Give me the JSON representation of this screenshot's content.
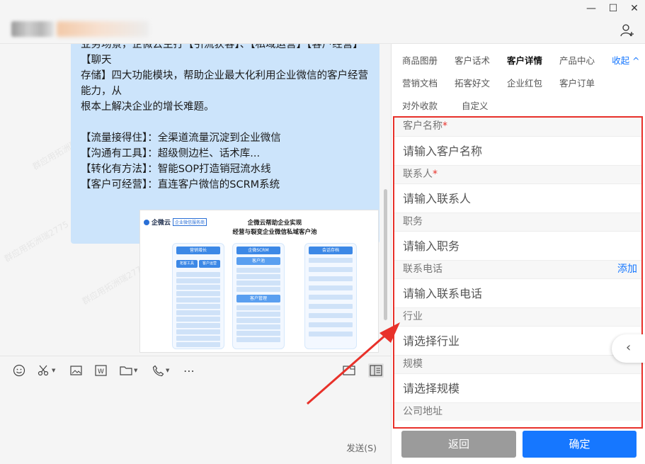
{
  "window": {
    "minimize_glyph": "—",
    "maximize_glyph": "☐",
    "close_glyph": "✕"
  },
  "chat": {
    "message_lines": [
      "业务场景，企微云主打【引流获客】、【私域运营】【客户经营】【聊天",
      "存储】四大功能模块，帮助企业最大化利用企业微信的客户经营能力，从",
      "根本上解决企业的增长难题。"
    ],
    "bullet_lines": [
      "【流量接得住】：全渠道流量沉淀到企业微信",
      "【沟通有工具】：超级侧边栏、话术库...",
      "【转化有方法】：智能SOP打造销冠流水线",
      "【客户可经营】：直连客户微信的SCRM系统"
    ],
    "watermark": "群应用拓洲瑞2775",
    "image": {
      "logo_text": "企微云",
      "logo_tag": "企业微信服务商",
      "title_line1": "企微云帮助企业实现",
      "title_line2": "经营与裂变企业微信私域客户池",
      "col1_header": "营销增长",
      "col1_sub1": "拓客工具",
      "col1_sub2": "客户运营",
      "col2_header": "企微SCRM",
      "col2_sub1": "客户池",
      "col2_sub2": "客户管理",
      "col3_header": "会话存档"
    }
  },
  "toolbar": {
    "send_label": "发送(S)"
  },
  "panel": {
    "tabs_row1": [
      "商品图册",
      "客户话术",
      "客户详情",
      "产品中心"
    ],
    "active_tab": "客户详情",
    "collapse_label": "收起 ^",
    "tabs_row2": [
      "营销文档",
      "拓客好文",
      "企业红包",
      "客户订单"
    ],
    "tabs_row3": [
      "对外收款",
      "自定义"
    ],
    "form": {
      "customer_name_label": "客户名称",
      "customer_name_placeholder": "请输入客户名称",
      "contact_label": "联系人",
      "contact_placeholder": "请输入联系人",
      "position_label": "职务",
      "position_placeholder": "请输入职务",
      "phone_label": "联系电话",
      "phone_add": "添加",
      "phone_placeholder": "请输入联系电话",
      "industry_label": "行业",
      "industry_placeholder": "请选择行业",
      "scale_label": "规模",
      "scale_placeholder": "请选择规模",
      "address_label": "公司地址",
      "required_mark": "*"
    },
    "back_label": "返回",
    "confirm_label": "确定"
  },
  "colors": {
    "accent": "#1677ff",
    "highlight_red": "#e8312a",
    "bubble": "#cce4fb"
  }
}
